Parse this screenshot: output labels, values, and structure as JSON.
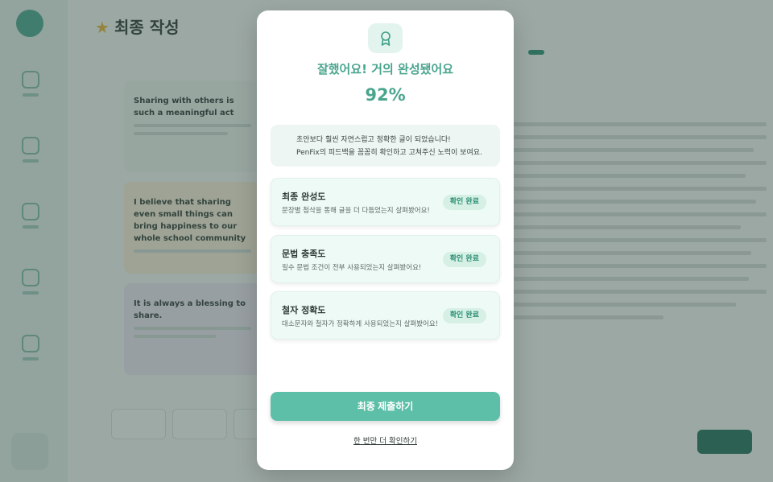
{
  "background": {
    "page_title": "최종 작성",
    "toolbar": {
      "chips": [
        "",
        "",
        ""
      ],
      "pill": ""
    },
    "cards": [
      {
        "tag": "",
        "title": "Sharing with others is such a meaningful act"
      },
      {
        "tag": "",
        "title": "I believe that sharing even small things can bring happiness to our whole school community"
      },
      {
        "tag": "",
        "title": "It is always a blessing to share."
      }
    ],
    "essay_title": "",
    "next_button": ""
  },
  "modal": {
    "title": "잘했어요! 거의 완성됐어요",
    "percent": "92%",
    "feedback": [
      "초안보다 훨씬 자연스럽고 정확한 글이 되었습니다!",
      "PenFix의 피드백을 꼼꼼히 확인하고 고쳐주신 노력이 보여요."
    ],
    "checks": [
      {
        "title": "최종 완성도",
        "desc": "문장별 첨삭을 통해 글을 더 다듬었는지 살펴봤어요!",
        "badge": "확인 완료"
      },
      {
        "title": "문법 충족도",
        "desc": "필수 문법 조건이 전부 사용되었는지 살펴봤어요!",
        "badge": "확인 완료"
      },
      {
        "title": "철자 정확도",
        "desc": "대소문자와 철자가 정확하게 사용되었는지 살펴봤어요!",
        "badge": "확인 완료"
      }
    ],
    "submit_label": "최종 제출하기",
    "recheck_label": "한 번만 더 확인하기",
    "icon": "award-ribbon-icon",
    "accent": "#5dbfa8"
  }
}
